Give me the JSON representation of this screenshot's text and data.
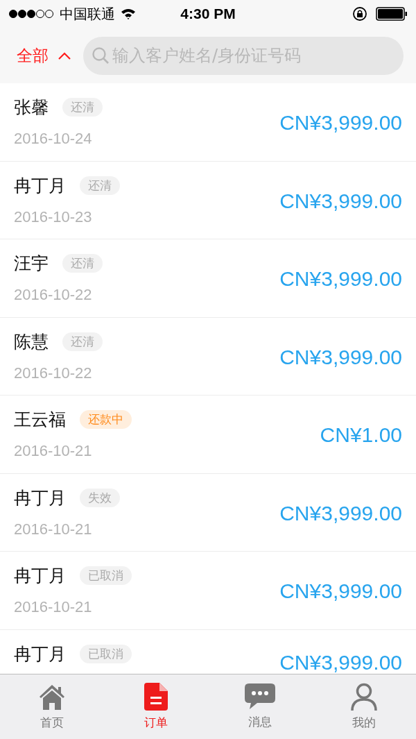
{
  "status_bar": {
    "carrier": "中国联通",
    "time": "4:30 PM"
  },
  "filter": {
    "label": "全部",
    "expanded": true
  },
  "search": {
    "placeholder": "输入客户姓名/身份证号码"
  },
  "orders": [
    {
      "name": "张馨",
      "status": "还清",
      "color": "#aaaaaa",
      "date": "2016-10-24",
      "amount": "CN¥3,999.00"
    },
    {
      "name": "冉丁月",
      "status": "还清",
      "color": "#aaaaaa",
      "date": "2016-10-23",
      "amount": "CN¥3,999.00"
    },
    {
      "name": "汪宇",
      "status": "还清",
      "color": "#aaaaaa",
      "date": "2016-10-22",
      "amount": "CN¥3,999.00"
    },
    {
      "name": "陈慧",
      "status": "还清",
      "color": "#aaaaaa",
      "date": "2016-10-22",
      "amount": "CN¥3,999.00"
    },
    {
      "name": "王云福",
      "status": "还款中",
      "color": "#ff8a1a",
      "date": "2016-10-21",
      "amount": "CN¥1.00"
    },
    {
      "name": "冉丁月",
      "status": "失效",
      "color": "#aaaaaa",
      "date": "2016-10-21",
      "amount": "CN¥3,999.00"
    },
    {
      "name": "冉丁月",
      "status": "已取消",
      "color": "#aaaaaa",
      "date": "2016-10-21",
      "amount": "CN¥3,999.00"
    },
    {
      "name": "冉丁月",
      "status": "已取消",
      "color": "#aaaaaa",
      "amount": "CN¥3,999.00"
    }
  ],
  "tabs": [
    {
      "label": "首页",
      "selected": false
    },
    {
      "label": "订单",
      "selected": true
    },
    {
      "label": "消息",
      "selected": false
    },
    {
      "label": "我的",
      "selected": false
    }
  ]
}
